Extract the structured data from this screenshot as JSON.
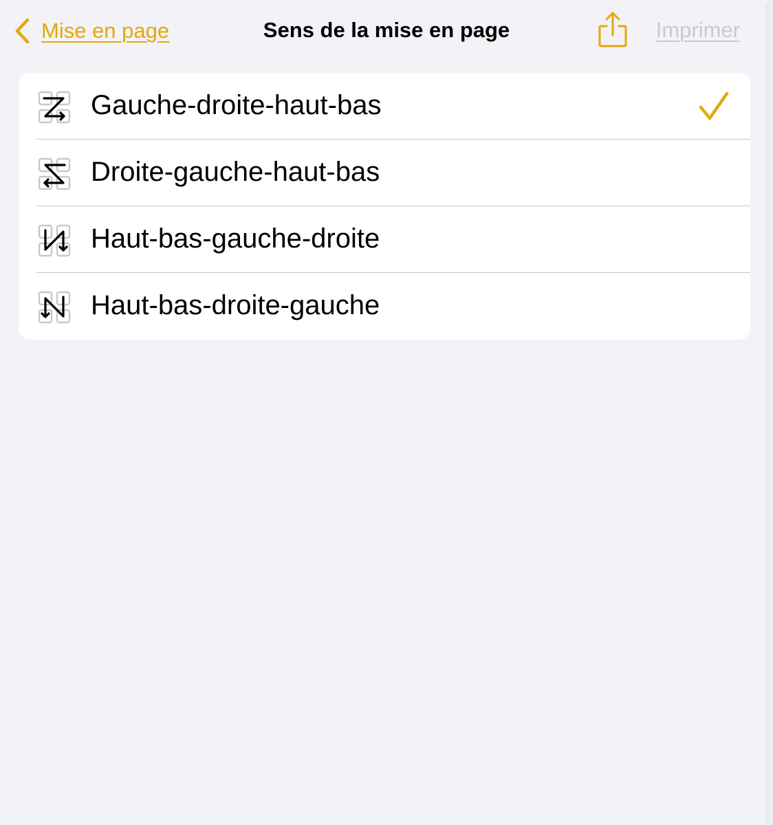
{
  "nav": {
    "back_label": "Mise en page",
    "title": "Sens de la mise en page",
    "share_icon": "share-icon",
    "print_label": "Imprimer"
  },
  "options": [
    {
      "label": "Gauche-droite-haut-bas",
      "icon": "left-right-top-bottom-icon",
      "selected": true
    },
    {
      "label": "Droite-gauche-haut-bas",
      "icon": "right-left-top-bottom-icon",
      "selected": false
    },
    {
      "label": "Haut-bas-gauche-droite",
      "icon": "top-bottom-left-right-icon",
      "selected": false
    },
    {
      "label": "Haut-bas-droite-gauche",
      "icon": "top-bottom-right-left-icon",
      "selected": false
    }
  ],
  "colors": {
    "accent": "#E1A90A",
    "background": "#F2F2F7",
    "card": "#FFFFFF",
    "separator": "#C6C6C8",
    "disabled": "#C9C9CE"
  }
}
